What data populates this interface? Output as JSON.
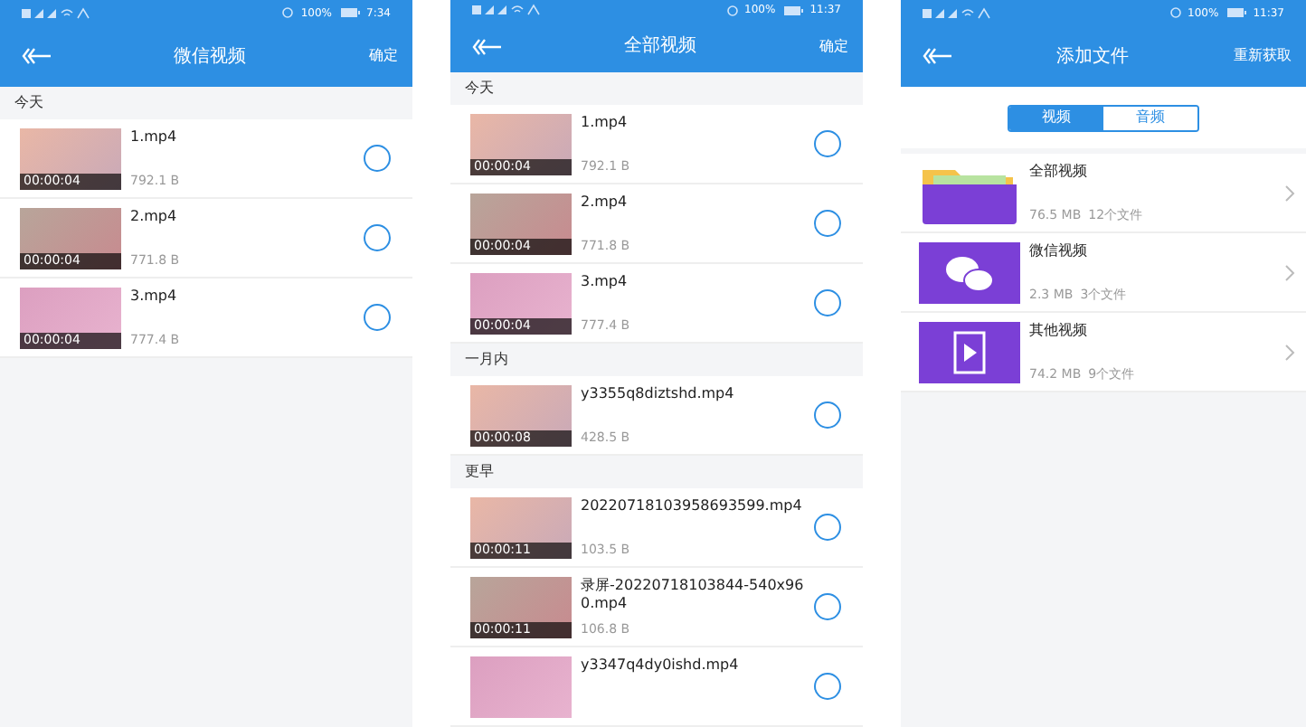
{
  "screens": [
    {
      "kind": "video_list",
      "status_bar": {
        "battery": "100%",
        "time": "7:34"
      },
      "header": {
        "title": "微信视频",
        "action": "确定"
      },
      "sections": [
        {
          "title": "今天",
          "files": [
            {
              "name": "1.mp4",
              "size": "792.1 B",
              "duration": "00:00:04",
              "selected": false
            },
            {
              "name": "2.mp4",
              "size": "771.8 B",
              "duration": "00:00:04",
              "selected": false
            },
            {
              "name": "3.mp4",
              "size": "777.4 B",
              "duration": "00:00:04",
              "selected": false
            }
          ]
        }
      ]
    },
    {
      "kind": "video_list",
      "status_bar": {
        "battery": "100%",
        "time": "11:37"
      },
      "header": {
        "title": "全部视频",
        "action": "确定"
      },
      "sections": [
        {
          "title": "今天",
          "files": [
            {
              "name": "1.mp4",
              "size": "792.1 B",
              "duration": "00:00:04",
              "selected": false
            },
            {
              "name": "2.mp4",
              "size": "771.8 B",
              "duration": "00:00:04",
              "selected": false
            },
            {
              "name": "3.mp4",
              "size": "777.4 B",
              "duration": "00:00:04",
              "selected": false
            }
          ]
        },
        {
          "title": "一月内",
          "files": [
            {
              "name": "y3355q8diztshd.mp4",
              "size": "428.5 B",
              "duration": "00:00:08",
              "selected": false
            }
          ]
        },
        {
          "title": "更早",
          "files": [
            {
              "name": "20220718103958693599.mp4",
              "size": "103.5 B",
              "duration": "00:00:11",
              "selected": false
            },
            {
              "name": "录屏-20220718103844-540x960.mp4",
              "size": "106.8 B",
              "duration": "00:00:11",
              "selected": false
            },
            {
              "name": "y3347q4dy0ishd.mp4",
              "selected": false
            }
          ]
        }
      ]
    },
    {
      "kind": "folder_list",
      "status_bar": {
        "battery": "100%",
        "time": "11:37"
      },
      "header": {
        "title": "添加文件",
        "action": "重新获取"
      },
      "tabs": [
        {
          "label": "视频",
          "selected": true
        },
        {
          "label": "音频",
          "selected": false
        }
      ],
      "folders": [
        {
          "name": "全部视频",
          "size": "76.5 MB",
          "count": "12个文件"
        },
        {
          "name": "微信视频",
          "size": "2.3 MB",
          "count": "3个文件"
        },
        {
          "name": "其他视频",
          "size": "74.2 MB",
          "count": "9个文件"
        }
      ]
    }
  ]
}
